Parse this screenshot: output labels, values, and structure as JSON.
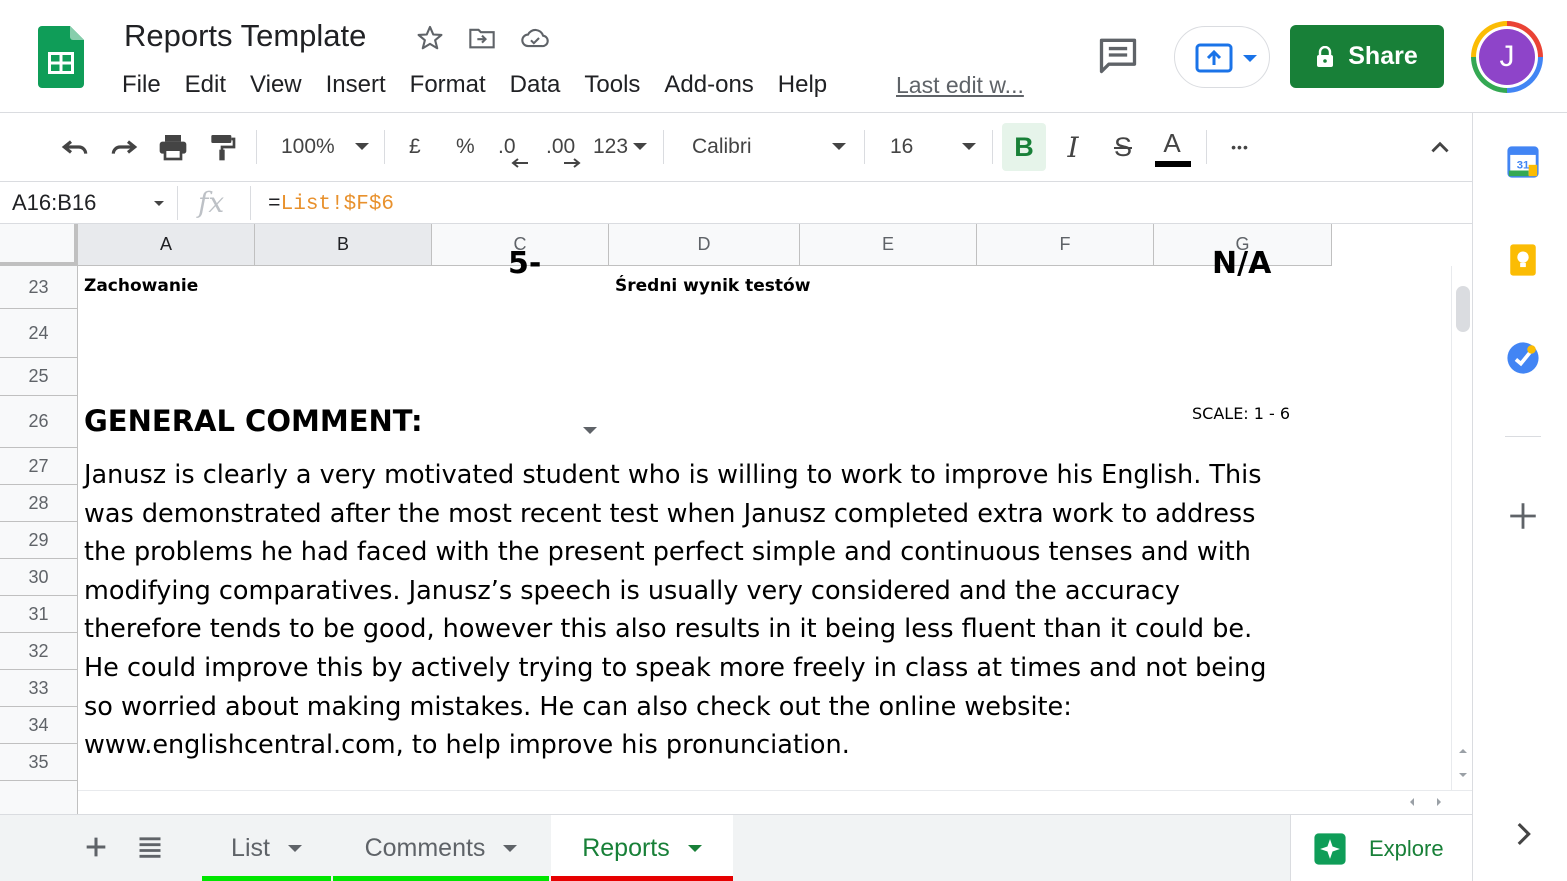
{
  "header": {
    "title": "Reports Template",
    "menu": [
      "File",
      "Edit",
      "View",
      "Insert",
      "Format",
      "Data",
      "Tools",
      "Add-ons",
      "Help"
    ],
    "last_edit": "Last edit w...",
    "share_label": "Share",
    "avatar_initial": "J"
  },
  "toolbar": {
    "zoom": "100%",
    "currency": "£",
    "percent": "%",
    "decrease_decimal": ".0",
    "increase_decimal": ".00",
    "more_formats": "123",
    "font": "Calibri",
    "font_size": "16",
    "bold": "B",
    "italic": "I",
    "strike": "S",
    "text_color": "A",
    "more": "•••"
  },
  "formula_bar": {
    "name_box": "A16:B16",
    "fx": "fx",
    "formula_eq": "=",
    "formula_ref": "List!$F$6"
  },
  "grid": {
    "columns": [
      "A",
      "B",
      "C",
      "D",
      "E",
      "F",
      "G"
    ],
    "rows": [
      "23",
      "24",
      "25",
      "26",
      "27",
      "28",
      "29",
      "30",
      "31",
      "32",
      "33",
      "34",
      "35"
    ],
    "cells": {
      "a23": "Zachowanie",
      "c23_partial": "5-",
      "d23": "Średni wynik testów",
      "g23_partial": "N/A",
      "a26": "GENERAL COMMENT:",
      "scale": "SCALE: 1 - 6"
    },
    "comment_lines": [
      "Janusz is clearly a very motivated student who is willing to work to improve his English. This",
      "was demonstrated after the most recent test when Janusz completed extra work to address",
      "the problems he had faced with the present perfect simple and continuous tenses and with",
      "modifying comparatives. Janusz’s speech is usually very considered and the accuracy",
      "therefore tends to be good, however this also results in it being less fluent than it could be.",
      "He could improve this by actively trying to speak more freely in class at times and not being",
      "so worried about making mistakes. He can also check out the online website:",
      "www.englishcentral.com, to help improve his pronunciation."
    ]
  },
  "sheets": {
    "tabs": [
      {
        "label": "List",
        "color": "#00e600"
      },
      {
        "label": "Comments",
        "color": "#00e600"
      },
      {
        "label": "Reports",
        "color": "#e60000"
      }
    ],
    "explore_label": "Explore"
  },
  "colors": {
    "brand_green": "#188038",
    "formula_ref": "#e8912d"
  }
}
